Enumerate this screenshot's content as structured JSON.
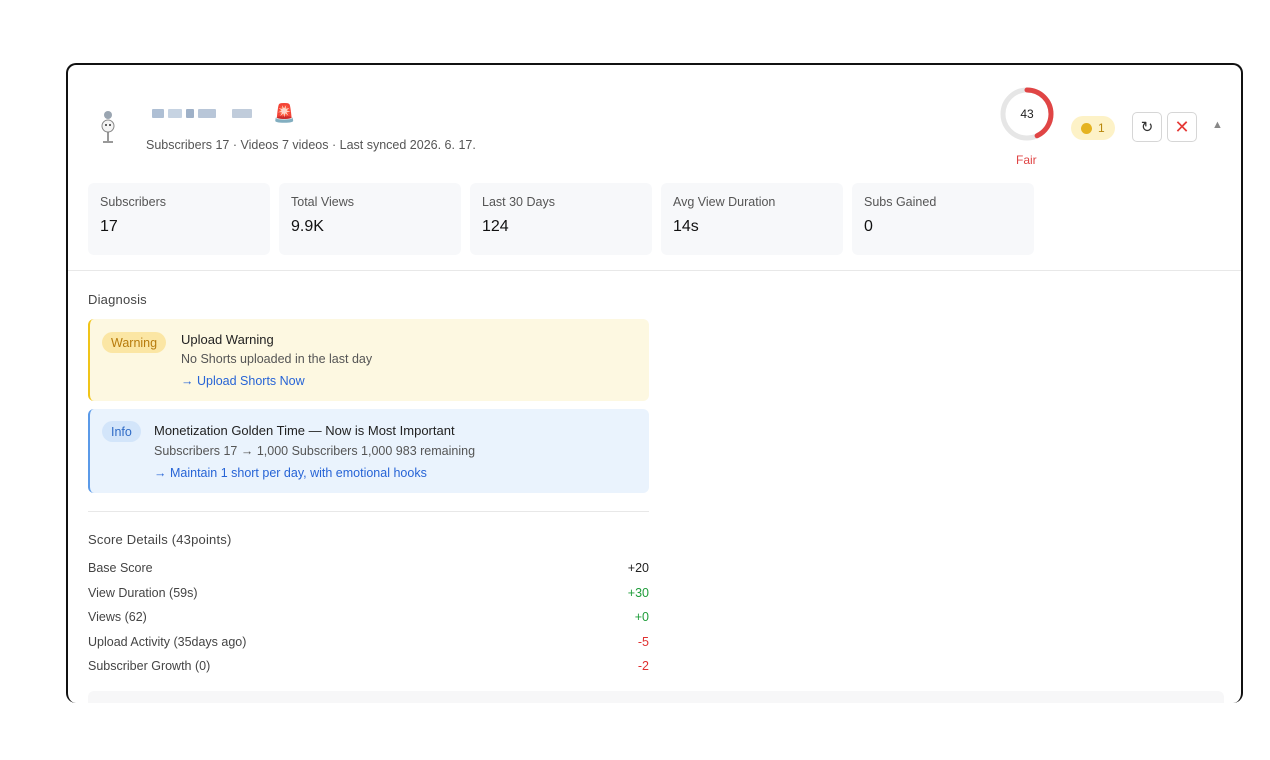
{
  "channel": {
    "meta": "Subscribers 17 · Videos 7 videos · Last synced 2026. 6. 17."
  },
  "score": {
    "value": "43",
    "fraction": 0.43,
    "label": "Fair",
    "color": "#e04545"
  },
  "coins": {
    "count": "1"
  },
  "icons": {
    "refresh": "refresh-icon",
    "close": "close-icon",
    "collapse": "chevron-up-icon",
    "alarm": "alarm-light-icon",
    "coin": "coin-icon"
  },
  "stats": [
    {
      "label": "Subscribers",
      "value": "17"
    },
    {
      "label": "Total Views",
      "value": "9.9K"
    },
    {
      "label": "Last 30 Days",
      "value": "124"
    },
    {
      "label": "Avg View Duration",
      "value": "14s"
    },
    {
      "label": "Subs Gained",
      "value": "0"
    }
  ],
  "diagnosis": {
    "title": "Diagnosis",
    "warning": {
      "badge": "Warning",
      "title": "Upload Warning",
      "text": "No Shorts uploaded in the last day",
      "action": "→ Upload Shorts Now"
    },
    "info": {
      "badge": "Info",
      "title": "Monetization Golden Time — Now is Most Important",
      "text": "Subscribers 17 → 1,000 Subscribers 1,000 983 remaining",
      "action": "→ Maintain 1 short per day, with emotional hooks"
    }
  },
  "score_details": {
    "title": "Score Details (43points)",
    "rows": [
      {
        "label": "Base Score",
        "value": "+20",
        "color": "#222222"
      },
      {
        "label": "View Duration (59s)",
        "value": "+30",
        "color": "#1f9d3a"
      },
      {
        "label": "Views (62)",
        "value": "+0",
        "color": "#1f9d3a"
      },
      {
        "label": "Upload Activity (35days ago)",
        "value": "-5",
        "color": "#e03131"
      },
      {
        "label": "Subscriber Growth (0)",
        "value": "-2",
        "color": "#e03131"
      }
    ]
  }
}
